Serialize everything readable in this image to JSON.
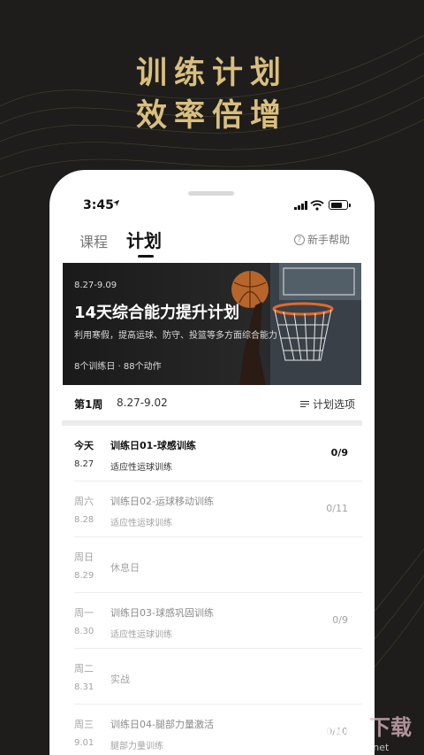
{
  "promo": {
    "line1": "训练计划",
    "line2": "效率倍增"
  },
  "status_bar": {
    "time": "3:45"
  },
  "tabs": [
    {
      "label": "课程",
      "active": false
    },
    {
      "label": "计划",
      "active": true
    }
  ],
  "help": {
    "label": "新手帮助",
    "icon": "question-circle-icon"
  },
  "banner": {
    "date_range": "8.27-9.09",
    "title": "14天综合能力提升计划",
    "subtitle": "利用寒假，提高运球、防守、投篮等多方面综合能力",
    "meta": "8个训练日 · 88个动作"
  },
  "week": {
    "label": "第1周",
    "range": "8.27-9.02",
    "options_label": "计划选项"
  },
  "days": [
    {
      "day": "今天",
      "date": "8.27",
      "name": "训练日01-球感训练",
      "sub": "适应性运球训练",
      "count": "0/9",
      "state": "active"
    },
    {
      "day": "周六",
      "date": "8.28",
      "name": "训练日02-运球移动训练",
      "sub": "适应性运球训练",
      "count": "0/11",
      "state": "dim"
    },
    {
      "day": "周日",
      "date": "8.29",
      "rest": "休息日",
      "state": "dim"
    },
    {
      "day": "周一",
      "date": "8.30",
      "name": "训练日03-球感巩固训练",
      "sub": "适应性运球训练",
      "count": "0/9",
      "state": "dim"
    },
    {
      "day": "周二",
      "date": "8.31",
      "rest": "实战",
      "state": "dim"
    },
    {
      "day": "周三",
      "date": "9.01",
      "name": "训练日04-腿部力量激活",
      "sub": "腿部力量训练",
      "count": "0/10",
      "state": "dim"
    }
  ],
  "watermark": {
    "text": "KK下载",
    "url_text": "www.kkx.net"
  },
  "colors": {
    "gold": "#d9bf7f",
    "background": "#1e1d1b",
    "text_dark": "#111111",
    "text_dim": "#a3a3a3"
  }
}
